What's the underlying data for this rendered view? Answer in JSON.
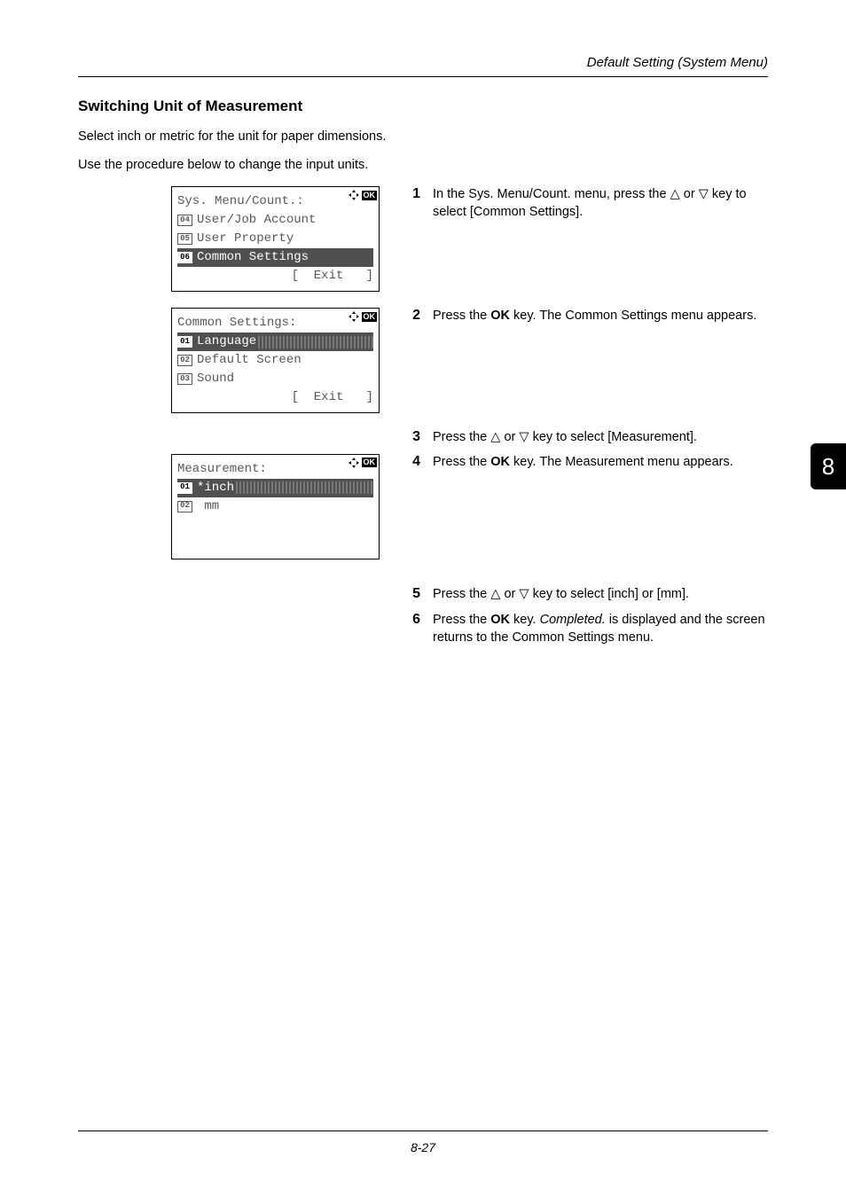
{
  "header": {
    "right": "Default Setting (System Menu)"
  },
  "section": {
    "title": "Switching Unit of Measurement",
    "p1": "Select inch or metric for the unit for paper dimensions.",
    "p2": "Use the procedure below to change the input units."
  },
  "lcd1": {
    "title": "Sys. Menu/Count.:",
    "line1_num": "04",
    "line1_text": "User/Job Account",
    "line2_num": "05",
    "line2_text": "User Property",
    "line3_num": "06",
    "line3_text": "Common Settings",
    "exit": "[  Exit   ]"
  },
  "lcd2": {
    "title": "Common Settings:",
    "line1_num": "01",
    "line1_text": "Language",
    "line2_num": "02",
    "line2_text": "Default Screen",
    "line3_num": "03",
    "line3_text": "Sound",
    "exit": "[  Exit   ]"
  },
  "lcd3": {
    "title": "Measurement:",
    "line1_num": "01",
    "line1_text": "*inch",
    "line2_num": "02",
    "line2_text": " mm"
  },
  "steps": {
    "s1a": "In the Sys. Menu/Count. menu, press the ",
    "s1b": " or ",
    "s1c": " key to select [Common Settings].",
    "s2a": "Press the ",
    "s2b": " key. The Common Settings menu appears.",
    "s3a": "Press the ",
    "s3b": " or ",
    "s3c": " key to select [Measurement].",
    "s4a": "Press the ",
    "s4b": " key. The Measurement menu appears.",
    "s5a": "Press the ",
    "s5b": " or ",
    "s5c": " key to select [inch] or [mm].",
    "s6a": "Press the ",
    "s6b": " key. ",
    "s6c": "Completed.",
    "s6d": " is displayed and the screen returns to the Common Settings menu."
  },
  "labels": {
    "ok": "OK",
    "okglyph": "OK"
  },
  "tab": "8",
  "footer": "8-27"
}
